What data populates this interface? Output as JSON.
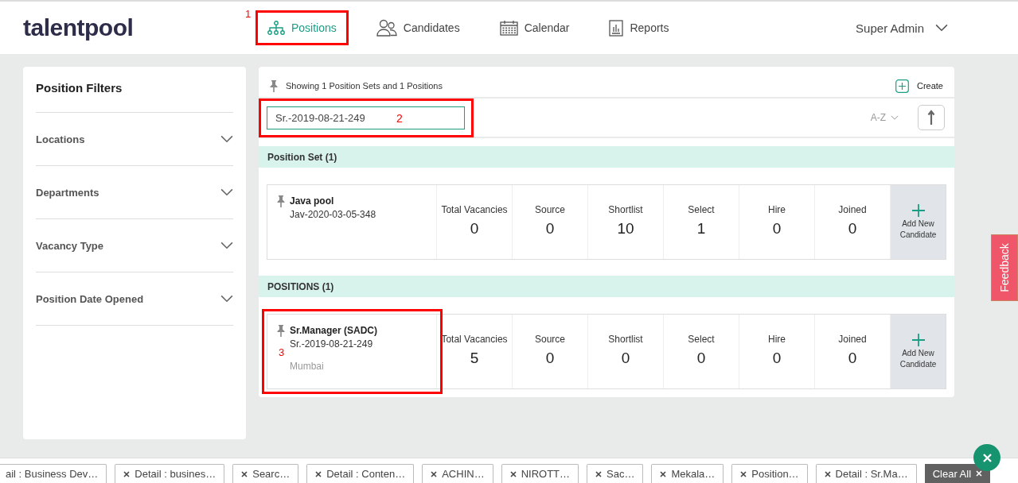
{
  "header": {
    "logo": "talentpool",
    "nav": [
      {
        "label": "Positions",
        "selected": true,
        "callout": "1"
      },
      {
        "label": "Candidates",
        "selected": false
      },
      {
        "label": "Calendar",
        "selected": false
      },
      {
        "label": "Reports",
        "selected": false
      }
    ],
    "user": "Super Admin"
  },
  "sidebar": {
    "title": "Position Filters",
    "filters": [
      {
        "label": "Locations",
        "expanded": false
      },
      {
        "label": "Departments",
        "expanded": false
      },
      {
        "label": "Vacancy Type",
        "expanded": false
      },
      {
        "label": "Position Date Opened",
        "expanded": false
      }
    ]
  },
  "main": {
    "summary": "Showing 1 Position Sets and 1 Positions",
    "create": "Create",
    "search": {
      "value": "Sr.-2019-08-21-249",
      "callout": "2"
    },
    "sort": "A-Z",
    "sections": [
      {
        "title": "Position Set (1)",
        "items": [
          {
            "name": "Java pool",
            "code": "Jav-2020-03-05-348",
            "stats": [
              {
                "label": "Total Vacancies",
                "value": "0"
              },
              {
                "label": "Source",
                "value": "0"
              },
              {
                "label": "Shortlist",
                "value": "10"
              },
              {
                "label": "Select",
                "value": "1"
              },
              {
                "label": "Hire",
                "value": "0"
              },
              {
                "label": "Joined",
                "value": "0"
              }
            ],
            "add": "Add New Candidate"
          }
        ]
      },
      {
        "title": "POSITIONS (1)",
        "items": [
          {
            "name": "Sr.Manager (SADC)",
            "code": "Sr.-2019-08-21-249",
            "location": "Mumbai",
            "callout": "3",
            "stats": [
              {
                "label": "Total Vacancies",
                "value": "5"
              },
              {
                "label": "Source",
                "value": "0"
              },
              {
                "label": "Shortlist",
                "value": "0"
              },
              {
                "label": "Select",
                "value": "0"
              },
              {
                "label": "Hire",
                "value": "0"
              },
              {
                "label": "Joined",
                "value": "0"
              }
            ],
            "add": "Add New Candidate"
          }
        ]
      }
    ]
  },
  "feedback": "Feedback",
  "tabs_bar": {
    "tabs": [
      {
        "label": "ail : Business Dev…",
        "closable": false
      },
      {
        "label": "Detail : busines…",
        "closable": true
      },
      {
        "label": "Searc…",
        "closable": true
      },
      {
        "label": "Detail : Conten…",
        "closable": true
      },
      {
        "label": "ACHIN…",
        "closable": true
      },
      {
        "label": "NIROTT…",
        "closable": true
      },
      {
        "label": "Sac…",
        "closable": true
      },
      {
        "label": "Mekala…",
        "closable": true
      },
      {
        "label": "Position…",
        "closable": true
      },
      {
        "label": "Detail : Sr.Ma…",
        "closable": true
      }
    ],
    "clear_all": "Clear All"
  }
}
